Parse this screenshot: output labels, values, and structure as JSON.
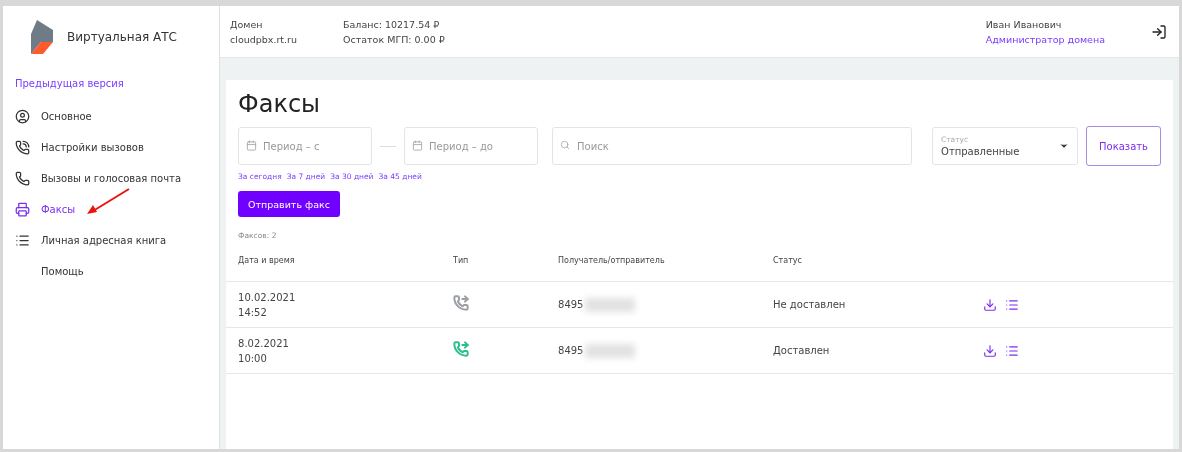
{
  "app": {
    "title": "Виртуальная АТС",
    "previous_version_link": "Предыдущая версия"
  },
  "sidebar": {
    "items": [
      {
        "label": "Основное",
        "selected": false
      },
      {
        "label": "Настройки вызовов",
        "selected": false
      },
      {
        "label": "Вызовы и голосовая почта",
        "selected": false
      },
      {
        "label": "Факсы",
        "selected": true
      },
      {
        "label": "Личная адресная книга",
        "selected": false
      },
      {
        "label": "Помощь",
        "selected": false
      }
    ]
  },
  "header": {
    "domain_label": "Домен",
    "domain": "cloudpbx.rt.ru",
    "balance": "Баланс: 10217.54 ₽",
    "remainder": "Остаток МГП: 0.00 ₽",
    "user_name": "Иван Иванович",
    "user_role": "Администратор домена"
  },
  "page": {
    "title": "Факсы",
    "filters": {
      "period_from": {
        "placeholder": "Период – с"
      },
      "period_to": {
        "placeholder": "Период – до"
      },
      "search": {
        "placeholder": "Поиск"
      },
      "status": {
        "label": "Статус",
        "value": "Отправленные"
      },
      "show_button": "Показать"
    },
    "quick_periods": [
      "За сегодня",
      "За 7 дней",
      "За 30 дней",
      "За 45 дней"
    ],
    "send_button": "Отправить факс",
    "count": "Факсов: 2",
    "table": {
      "columns": [
        "Дата и время",
        "Тип",
        "Получатель/отправитель",
        "Статус"
      ],
      "rows": [
        {
          "date": "10.02.2021",
          "time": "14:52",
          "color": "#9aa0a6",
          "number": "8495",
          "redacted": true,
          "status": "Не доставлен"
        },
        {
          "date": "8.02.2021",
          "time": "10:00",
          "color": "#2bbf8a",
          "number": "8495",
          "redacted": true,
          "status": "Доставлен"
        }
      ]
    }
  }
}
